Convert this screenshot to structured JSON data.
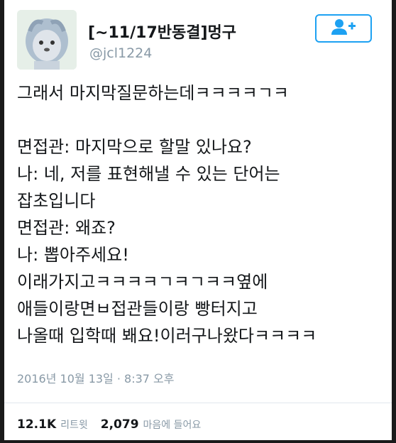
{
  "profile": {
    "name": "[~11/17반동결]멍구",
    "handle": "@jcl1224",
    "avatar_icon": "cartoon-avatar-icon",
    "follow_icon": "follow-user-icon",
    "accent_color": "#1da1f2"
  },
  "tweet": {
    "lines": [
      "그래서 마지막질문하는데ㅋㅋㅋㅋㄱㅋ",
      "",
      "면접관: 마지막으로 할말 있나요?",
      "나: 네, 저를 표현해낼 수 있는 단어는",
      "잡초입니다",
      "면접관: 왜죠?",
      "나: 뽑아주세요!",
      "이래가지고ㅋㅋㅋㅋㄱㅋㄱㅋㅋ옆에",
      "애들이랑면ㅂ접관들이랑 빵터지고",
      "나올때 입학때 봬요!이러구나왔다ㅋㅋㅋㅋ"
    ],
    "timestamp": "2016년 10월 13일 · 8:37 오후"
  },
  "stats": {
    "retweets_count": "12.1K",
    "retweets_label": "리트윗",
    "likes_count": "2,079",
    "likes_label": "마음에 들어요"
  }
}
